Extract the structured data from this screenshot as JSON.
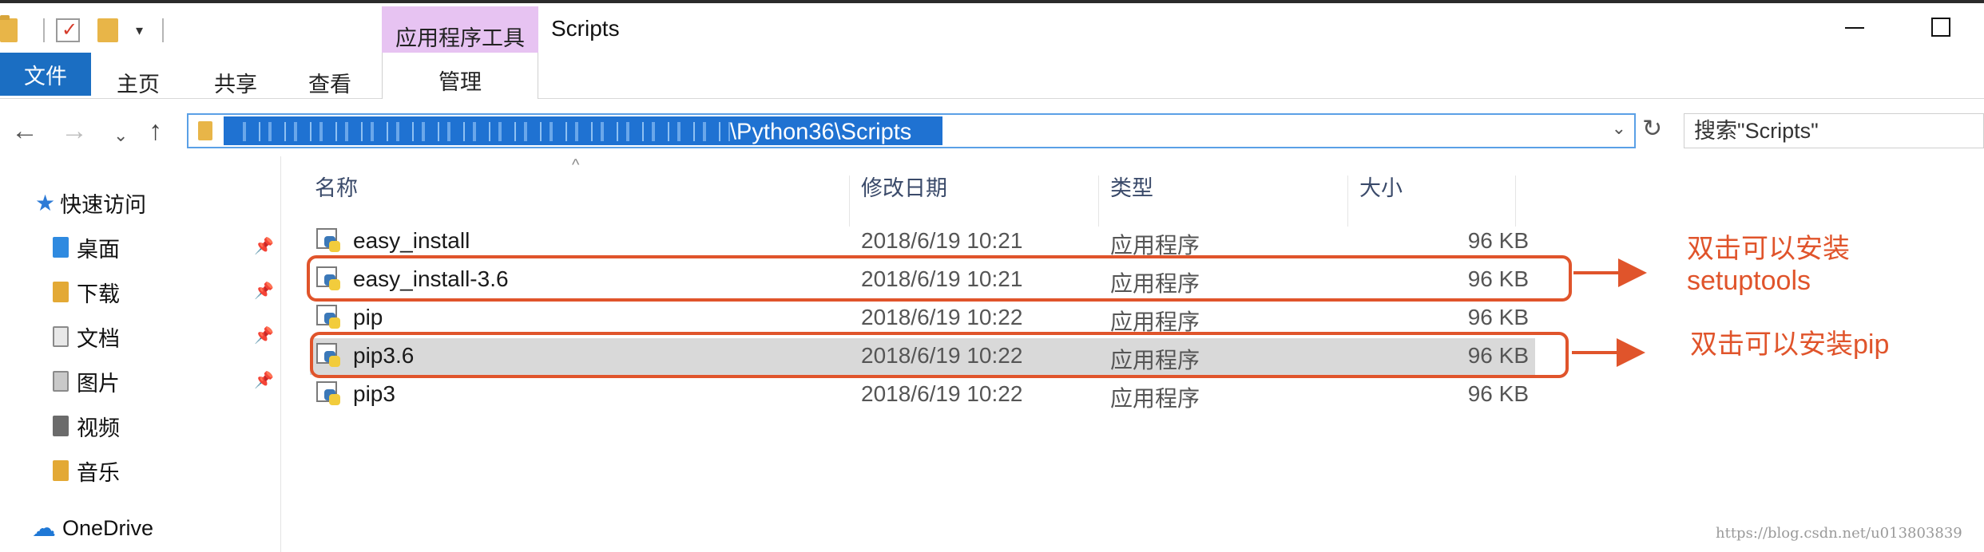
{
  "window": {
    "title": "Scripts",
    "context_tool_group": "应用程序工具"
  },
  "ribbon": {
    "tabs": [
      {
        "label": "文件",
        "active": true
      },
      {
        "label": "主页"
      },
      {
        "label": "共享"
      },
      {
        "label": "查看"
      },
      {
        "label": "管理"
      }
    ]
  },
  "address": {
    "path_visible_tail": "\\Python36\\Scripts",
    "search_placeholder": "搜索\"Scripts\""
  },
  "nav": {
    "quick_access": "快速访问",
    "items": [
      {
        "label": "桌面",
        "pinned": true,
        "icon": "desktop-icon"
      },
      {
        "label": "下载",
        "pinned": true,
        "icon": "download-icon"
      },
      {
        "label": "文档",
        "pinned": true,
        "icon": "document-icon"
      },
      {
        "label": "图片",
        "pinned": true,
        "icon": "picture-icon"
      },
      {
        "label": "视频",
        "pinned": false,
        "icon": "video-icon"
      },
      {
        "label": "音乐",
        "pinned": false,
        "icon": "music-icon"
      }
    ],
    "onedrive": "OneDrive"
  },
  "columns": {
    "name": "名称",
    "date": "修改日期",
    "type": "类型",
    "size": "大小"
  },
  "files": [
    {
      "name": "easy_install",
      "date": "2018/6/19 10:21",
      "type": "应用程序",
      "size": "96 KB"
    },
    {
      "name": "easy_install-3.6",
      "date": "2018/6/19 10:21",
      "type": "应用程序",
      "size": "96 KB"
    },
    {
      "name": "pip",
      "date": "2018/6/19 10:22",
      "type": "应用程序",
      "size": "96 KB"
    },
    {
      "name": "pip3.6",
      "date": "2018/6/19 10:22",
      "type": "应用程序",
      "size": "96 KB",
      "selected": true
    },
    {
      "name": "pip3",
      "date": "2018/6/19 10:22",
      "type": "应用程序",
      "size": "96 KB"
    }
  ],
  "annotations": {
    "note1_line1": "双击可以安装",
    "note1_line2": "setuptools",
    "note2": "双击可以安装pip",
    "color": "#e0542b"
  },
  "watermark": "https://blog.csdn.net/u013803839"
}
